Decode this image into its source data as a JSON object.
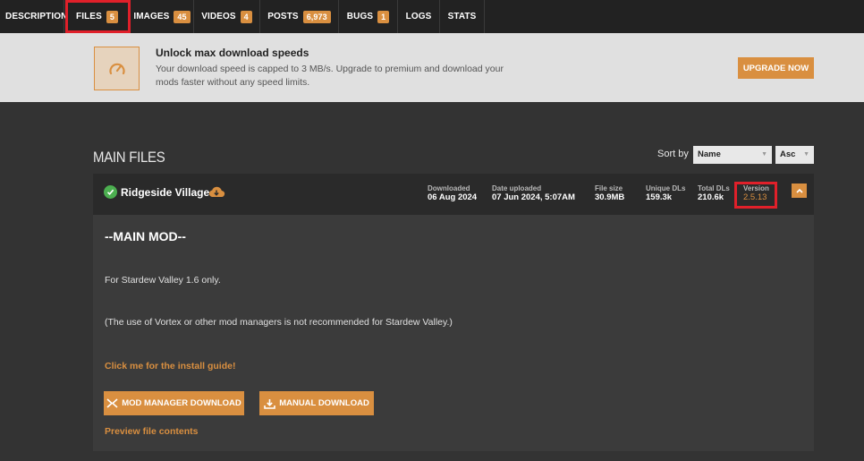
{
  "tabs": [
    {
      "label": "DESCRIPTION",
      "badge": ""
    },
    {
      "label": "FILES",
      "badge": "5"
    },
    {
      "label": "IMAGES",
      "badge": "45"
    },
    {
      "label": "VIDEOS",
      "badge": "4"
    },
    {
      "label": "POSTS",
      "badge": "6,973"
    },
    {
      "label": "BUGS",
      "badge": "1"
    },
    {
      "label": "LOGS",
      "badge": ""
    },
    {
      "label": "STATS",
      "badge": ""
    }
  ],
  "promo": {
    "icon": "speedometer-icon",
    "title": "Unlock max download speeds",
    "text": "Your download speed is capped to 3 MB/s. Upgrade to premium and download your mods faster without any speed limits.",
    "button": "UPGRADE NOW"
  },
  "section": {
    "title": "MAIN FILES",
    "sort_label": "Sort by",
    "sort_value": "Name",
    "order_value": "Asc"
  },
  "file": {
    "name": "Ridgeside Village",
    "stats": [
      {
        "label": "Downloaded",
        "value": "06 Aug 2024"
      },
      {
        "label": "Date uploaded",
        "value": "07 Jun 2024, 5:07AM"
      },
      {
        "label": "File size",
        "value": "30.9MB"
      },
      {
        "label": "Unique DLs",
        "value": "159.3k"
      },
      {
        "label": "Total DLs",
        "value": "210.6k"
      },
      {
        "label": "Version",
        "value": "2.5.13"
      }
    ],
    "heading": "--MAIN MOD--",
    "desc1": "For Stardew Valley 1.6 only.",
    "desc2": "(The use of Vortex or other mod managers is not recommended for Stardew Valley.)",
    "install_link": "Click me for the install guide!",
    "mod_manager_button": "MOD MANAGER DOWNLOAD",
    "manual_button": "MANUAL DOWNLOAD",
    "preview_link": "Preview file contents"
  },
  "colors": {
    "accent": "#d98f40",
    "highlight": "#e0202a",
    "success": "#4caf50"
  }
}
